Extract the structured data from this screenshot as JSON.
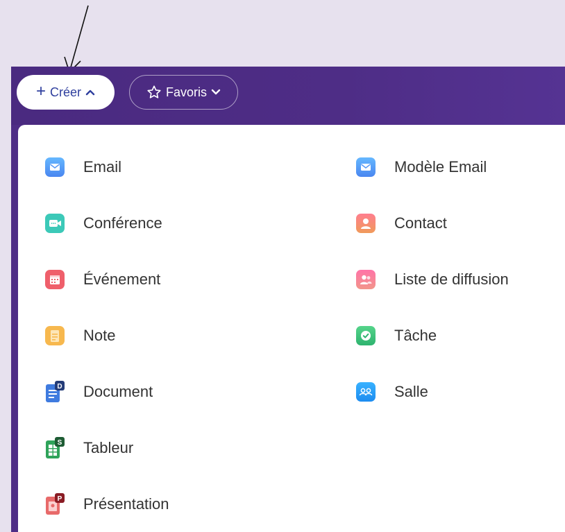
{
  "header": {
    "create_label": "Créer",
    "favorites_label": "Favoris"
  },
  "menu": {
    "left": [
      {
        "label": "Email",
        "icon": "mail-icon"
      },
      {
        "label": "Conférence",
        "icon": "video-conference-icon"
      },
      {
        "label": "Événement",
        "icon": "calendar-icon"
      },
      {
        "label": "Note",
        "icon": "note-icon"
      },
      {
        "label": "Document",
        "icon": "document-icon"
      },
      {
        "label": "Tableur",
        "icon": "spreadsheet-icon"
      },
      {
        "label": "Présentation",
        "icon": "presentation-icon"
      }
    ],
    "right": [
      {
        "label": "Modèle Email",
        "icon": "mail-template-icon"
      },
      {
        "label": "Contact",
        "icon": "contact-icon"
      },
      {
        "label": "Liste de diffusion",
        "icon": "mailing-list-icon"
      },
      {
        "label": "Tâche",
        "icon": "task-icon"
      },
      {
        "label": "Salle",
        "icon": "room-icon"
      }
    ]
  },
  "colors": {
    "topbar": "#4e2d86",
    "create_text": "#2f3f9e",
    "page_background": "#e7e1ee"
  }
}
